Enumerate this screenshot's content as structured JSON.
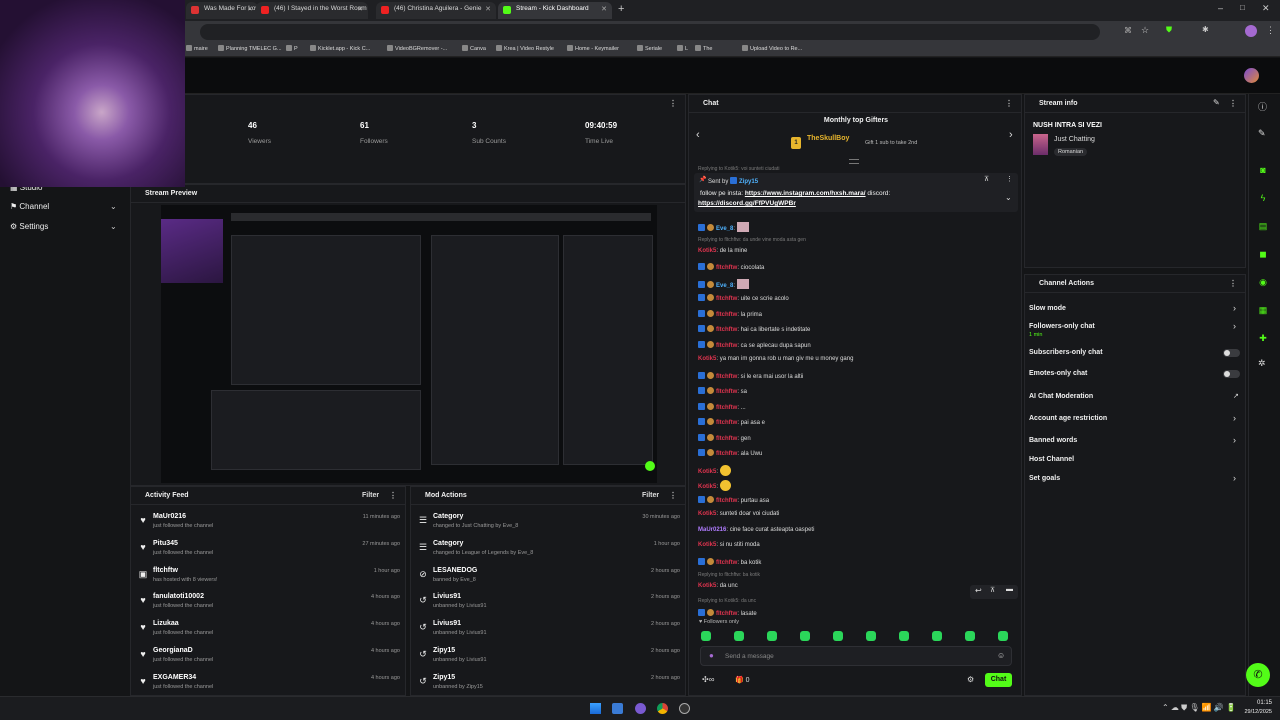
{
  "browser": {
    "tabs": [
      {
        "title": "Was Made For Lovi",
        "color": "#d33"
      },
      {
        "title": "(46) I Stayed in the Worst Room",
        "color": "#e22"
      },
      {
        "title": "(46) Christina Aguilera - Genie",
        "color": "#e22"
      },
      {
        "title": "Stream - Kick Dashboard",
        "color": "#53fc18"
      }
    ],
    "bookmarks": [
      "maire",
      "Planning TMELEC G...",
      "P",
      "Kicklet.app - Kick C...",
      "VideoBGRemover -...",
      "Canva",
      "Krea | Video Restyle",
      "Home - Keymailer",
      "Seriale",
      "L",
      "The",
      "Upload Video to Re..."
    ]
  },
  "nav": {
    "items": [
      "Studio",
      "Channel",
      "Settings"
    ]
  },
  "stats": [
    {
      "value": "46",
      "label": "Viewers"
    },
    {
      "value": "61",
      "label": "Followers"
    },
    {
      "value": "3",
      "label": "Sub Counts"
    },
    {
      "value": "09:40:59",
      "label": "Time Live"
    }
  ],
  "preview": {
    "title": "Stream Preview"
  },
  "activity": {
    "title": "Activity Feed",
    "filter": "Filter",
    "rows": [
      {
        "icon": "heart-icon",
        "glyph": "♥",
        "name": "MaUr0216",
        "sub": "just followed the channel",
        "time": "11 minutes ago"
      },
      {
        "icon": "heart-icon",
        "glyph": "♥",
        "name": "Pitu345",
        "sub": "just followed the channel",
        "time": "27 minutes ago"
      },
      {
        "icon": "host-icon",
        "glyph": "▣",
        "name": "fltchftw",
        "sub": "has hosted with 8 viewers!",
        "time": "1 hour ago"
      },
      {
        "icon": "heart-icon",
        "glyph": "♥",
        "name": "fanulatoti10002",
        "sub": "just followed the channel",
        "time": "4 hours ago"
      },
      {
        "icon": "heart-icon",
        "glyph": "♥",
        "name": "Lizukaa",
        "sub": "just followed the channel",
        "time": "4 hours ago"
      },
      {
        "icon": "heart-icon",
        "glyph": "♥",
        "name": "GeorgianaD",
        "sub": "just followed the channel",
        "time": "4 hours ago"
      },
      {
        "icon": "heart-icon",
        "glyph": "♥",
        "name": "EXGAMER34",
        "sub": "just followed the channel",
        "time": "4 hours ago"
      }
    ]
  },
  "mod": {
    "title": "Mod Actions",
    "filter": "Filter",
    "rows": [
      {
        "icon": "category-icon",
        "glyph": "☰",
        "name": "Category",
        "sub": "changed to Just Chatting by Eve_8",
        "time": "30 minutes ago"
      },
      {
        "icon": "category-icon",
        "glyph": "☰",
        "name": "Category",
        "sub": "changed to League of Legends by Eve_8",
        "time": "1 hour ago"
      },
      {
        "icon": "ban-icon",
        "glyph": "⊘",
        "name": "LESANEDOG",
        "sub": "banned by Eve_8",
        "time": "2 hours ago"
      },
      {
        "icon": "undo-icon",
        "glyph": "↺",
        "name": "Livius91",
        "sub": "unbanned by Livius91",
        "time": "2 hours ago"
      },
      {
        "icon": "undo-icon",
        "glyph": "↺",
        "name": "Livius91",
        "sub": "unbanned by Livius91",
        "time": "2 hours ago"
      },
      {
        "icon": "undo-icon",
        "glyph": "↺",
        "name": "Zipy15",
        "sub": "unbanned by Livius91",
        "time": "2 hours ago"
      },
      {
        "icon": "undo-icon",
        "glyph": "↺",
        "name": "Zipy15",
        "sub": "unbanned by Zipy15",
        "time": "2 hours ago"
      }
    ]
  },
  "chat": {
    "title": "Chat",
    "gifters_title": "Monthly top Gifters",
    "top_gifter": "TheSkullBoy",
    "gift_hint": "Gift 1 sub to take 2nd",
    "pinned_by_label": "Sent by",
    "pinned_by": "Zipy15",
    "pinned_text": "follow pe insta:",
    "pinned_link1": "https://www.instagram.com/hxsh.mara/",
    "pinned_mid": "discord:",
    "pinned_link2": "https://discord.gg/FfPVUgWPBr",
    "top_reply": "Replying to Kotik5: voi sunteti ciudati",
    "messages": [
      {
        "user": "Eve_8",
        "text": "",
        "color": "#4fb3ff",
        "kind": "emote"
      },
      {
        "user": "",
        "text": "Replying to fltchftw: da unde vine moda asta gen",
        "color": "",
        "kind": "reply"
      },
      {
        "user": "Kotik5",
        "text": "de la mine",
        "color": "#e0344f",
        "kind": "msg"
      },
      {
        "user": "fltchftw",
        "text": "ciocolata",
        "color": "#e0344f",
        "kind": "msg"
      },
      {
        "user": "Eve_8",
        "text": "",
        "color": "#4fb3ff",
        "kind": "emote"
      },
      {
        "user": "fltchftw",
        "text": "uite ce scrie acolo",
        "color": "#e0344f",
        "kind": "msg"
      },
      {
        "user": "fltchftw",
        "text": "la prima",
        "color": "#e0344f",
        "kind": "msg"
      },
      {
        "user": "fltchftw",
        "text": "hai ca libertate s indetitate",
        "color": "#e0344f",
        "kind": "msg"
      },
      {
        "user": "fltchftw",
        "text": "ca se aplecau dupa sapun",
        "color": "#e0344f",
        "kind": "msg"
      },
      {
        "user": "Kotik5",
        "text": "ya man im gonna rob u man giv me u money gang",
        "color": "#e0344f",
        "kind": "msg"
      },
      {
        "user": "fltchftw",
        "text": "si le era mai usor la altii",
        "color": "#e0344f",
        "kind": "msg"
      },
      {
        "user": "fltchftw",
        "text": "sa",
        "color": "#e0344f",
        "kind": "msg"
      },
      {
        "user": "fltchftw",
        "text": "...",
        "color": "#e0344f",
        "kind": "msg"
      },
      {
        "user": "fltchftw",
        "text": "pai asa e",
        "color": "#e0344f",
        "kind": "msg"
      },
      {
        "user": "fltchftw",
        "text": "gen",
        "color": "#e0344f",
        "kind": "msg"
      },
      {
        "user": "fltchftw",
        "text": "ala Uwu",
        "color": "#e0344f",
        "kind": "msg"
      },
      {
        "user": "Kotik5",
        "text": "",
        "color": "#e0344f",
        "kind": "emoji"
      },
      {
        "user": "Kotik5",
        "text": "",
        "color": "#e0344f",
        "kind": "emoji"
      },
      {
        "user": "fltchftw",
        "text": "purtau asa",
        "color": "#e0344f",
        "kind": "msg"
      },
      {
        "user": "Kotik5",
        "text": "sunteti doar voi ciudati",
        "color": "#e0344f",
        "kind": "msg"
      },
      {
        "user": "MaUr0216",
        "text": "cine face curat asteapta oaspeti",
        "color": "#b07cff",
        "kind": "msg"
      },
      {
        "user": "Kotik5",
        "text": "si nu stiti moda",
        "color": "#e0344f",
        "kind": "msg"
      },
      {
        "user": "fltchftw",
        "text": "ba kotik",
        "color": "#e0344f",
        "kind": "msg"
      },
      {
        "user": "",
        "text": "Replying to fltchftw: ba kotik",
        "color": "",
        "kind": "reply"
      },
      {
        "user": "Kotik5",
        "text": "da unc",
        "color": "#e0344f",
        "kind": "msg"
      },
      {
        "user": "",
        "text": "Replying to Kotik5: da unc",
        "color": "",
        "kind": "reply"
      },
      {
        "user": "fltchftw",
        "text": "lasate",
        "color": "#e0344f",
        "kind": "msg"
      }
    ],
    "followers_only": "Followers only",
    "input_placeholder": "Send a message",
    "count": "0",
    "send_label": "Chat"
  },
  "stream_info": {
    "title": "Stream info",
    "stream_title": "NUSH INTRA SI VEZI",
    "category": "Just Chatting",
    "language": "Romanian"
  },
  "channel_actions": {
    "title": "Channel Actions",
    "rows": [
      {
        "label": "Slow mode",
        "sub": "",
        "control": "chevron"
      },
      {
        "label": "Followers-only chat",
        "sub": "1 min",
        "control": "chevron"
      },
      {
        "label": "Subscribers-only chat",
        "sub": "",
        "control": "toggle"
      },
      {
        "label": "Emotes-only chat",
        "sub": "",
        "control": "toggle"
      },
      {
        "label": "AI Chat Moderation",
        "sub": "",
        "control": "external"
      },
      {
        "label": "Account age restriction",
        "sub": "",
        "control": "chevron"
      },
      {
        "label": "Banned words",
        "sub": "",
        "control": "chevron"
      },
      {
        "label": "Host Channel",
        "sub": "",
        "control": "none"
      },
      {
        "label": "Set goals",
        "sub": "",
        "control": "chevron"
      }
    ]
  },
  "clock": {
    "time": "01:15",
    "date": "29/12/2025"
  },
  "colors": {
    "accent": "#53fc18",
    "bg": "#141517",
    "panel": "#17181b"
  }
}
